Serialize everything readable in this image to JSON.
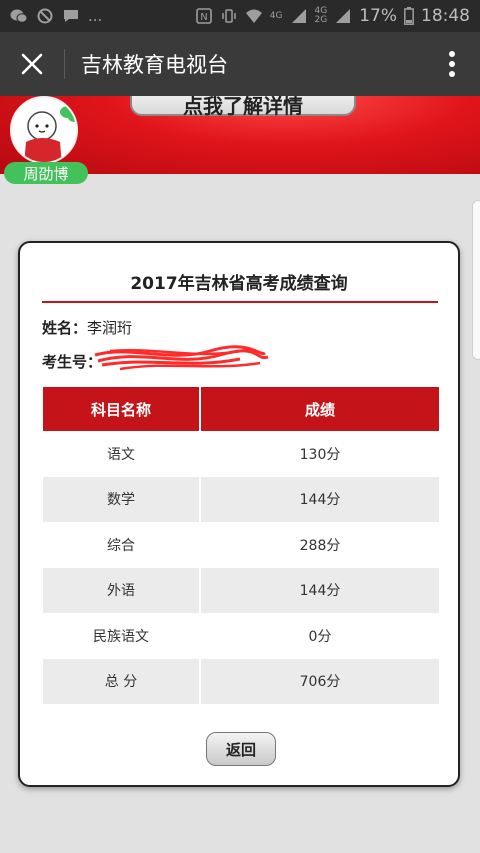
{
  "status_bar": {
    "battery": "17%",
    "time": "18:48",
    "signal_4g_a": "4G",
    "signal_4g_b": "4G",
    "signal_2g": "2G",
    "ellipsis": "..."
  },
  "header": {
    "title": "吉林教育电视台"
  },
  "banner": {
    "button_text": "点我了解详情",
    "user_badge": "周劭博"
  },
  "card": {
    "title": "2017年吉林省高考成绩查询",
    "name_label": "姓名：",
    "name_value": "李润珩",
    "exam_label": "考生号：",
    "table": {
      "headers": [
        "科目名称",
        "成绩"
      ],
      "rows": [
        [
          "语文",
          "130分"
        ],
        [
          "数学",
          "144分"
        ],
        [
          "综合",
          "288分"
        ],
        [
          "外语",
          "144分"
        ],
        [
          "民族语文",
          "0分"
        ],
        [
          "总 分",
          "706分"
        ]
      ]
    },
    "back_label": "返回"
  },
  "colors": {
    "accent_red": "#c4141a",
    "badge_green": "#43c15a",
    "title_bar": "#3a3a3a"
  }
}
